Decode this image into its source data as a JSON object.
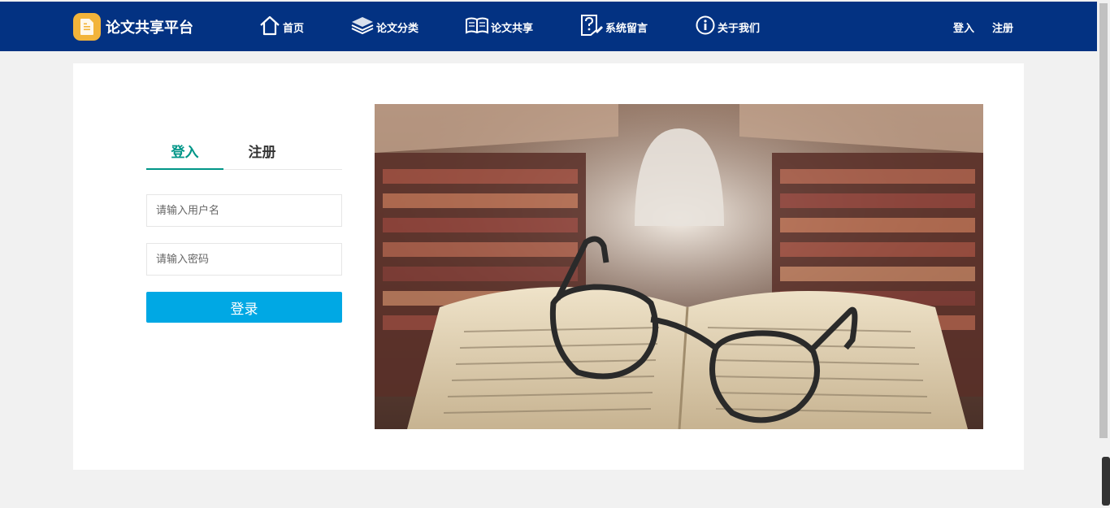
{
  "brand": {
    "name": "论文共享平台",
    "logo_icon": "document-icon",
    "logo_color": "#f2b43a"
  },
  "nav": {
    "background": "#033282",
    "items": [
      {
        "label": "首页",
        "icon": "home-icon"
      },
      {
        "label": "论文分类",
        "icon": "layers-icon"
      },
      {
        "label": "论文共享",
        "icon": "book-icon"
      },
      {
        "label": "系统留言",
        "icon": "question-icon"
      },
      {
        "label": "关于我们",
        "icon": "info-icon"
      }
    ],
    "login": "登入",
    "register": "注册"
  },
  "auth_form": {
    "tabs": [
      {
        "label": "登入",
        "active": true
      },
      {
        "label": "注册",
        "active": false
      }
    ],
    "accent": "#009688",
    "username_placeholder": "请输入用户名",
    "username_value": "",
    "password_placeholder": "请输入密码",
    "password_value": "",
    "submit_label": "登录",
    "submit_color": "#00a8e4"
  },
  "hero": {
    "icon": "library-photo"
  }
}
